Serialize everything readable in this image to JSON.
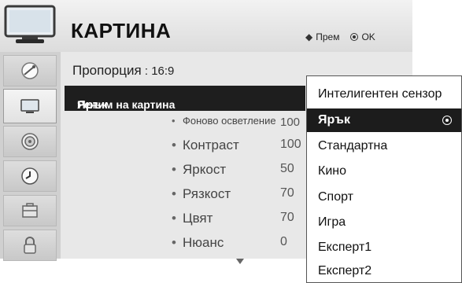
{
  "header": {
    "title": "КАРТИНА",
    "hint_move": "Прем",
    "hint_ok": "OK",
    "icon": "tv-icon"
  },
  "sidebar": {
    "items": [
      {
        "icon": "satellite-dish-icon",
        "active": false
      },
      {
        "icon": "picture-tv-icon",
        "active": true
      },
      {
        "icon": "speaker-icon",
        "active": false
      },
      {
        "icon": "clock-icon",
        "active": false
      },
      {
        "icon": "toolbox-icon",
        "active": false
      },
      {
        "icon": "lock-icon",
        "active": false
      }
    ]
  },
  "main": {
    "ratio_label": "Пропорция",
    "ratio_sep": " : ",
    "ratio_value": "16:9",
    "mode_label": "Режим на картина",
    "mode_sep": " : ",
    "mode_value": "Ярък",
    "settings": [
      {
        "label": "Фоново осветление",
        "value": "100"
      },
      {
        "label": "Контраст",
        "value": "100"
      },
      {
        "label": "Яркост",
        "value": "50"
      },
      {
        "label": "Рязкост",
        "value": "70"
      },
      {
        "label": "Цвят",
        "value": "70"
      },
      {
        "label": "Нюанс",
        "value": "0"
      }
    ]
  },
  "popup": {
    "options": [
      {
        "label": "Интелигентен сензор",
        "selected": false
      },
      {
        "label": "Ярък",
        "selected": true
      },
      {
        "label": "Стандартна",
        "selected": false
      },
      {
        "label": "Кино",
        "selected": false
      },
      {
        "label": "Спорт",
        "selected": false
      },
      {
        "label": "Игра",
        "selected": false
      },
      {
        "label": "Експерт1",
        "selected": false
      },
      {
        "label": "Експерт2",
        "selected": false
      }
    ]
  },
  "colors": {
    "highlight": "#1c1c1c",
    "panel": "#e8e8e8",
    "sidebar": "#d0d0d0"
  }
}
